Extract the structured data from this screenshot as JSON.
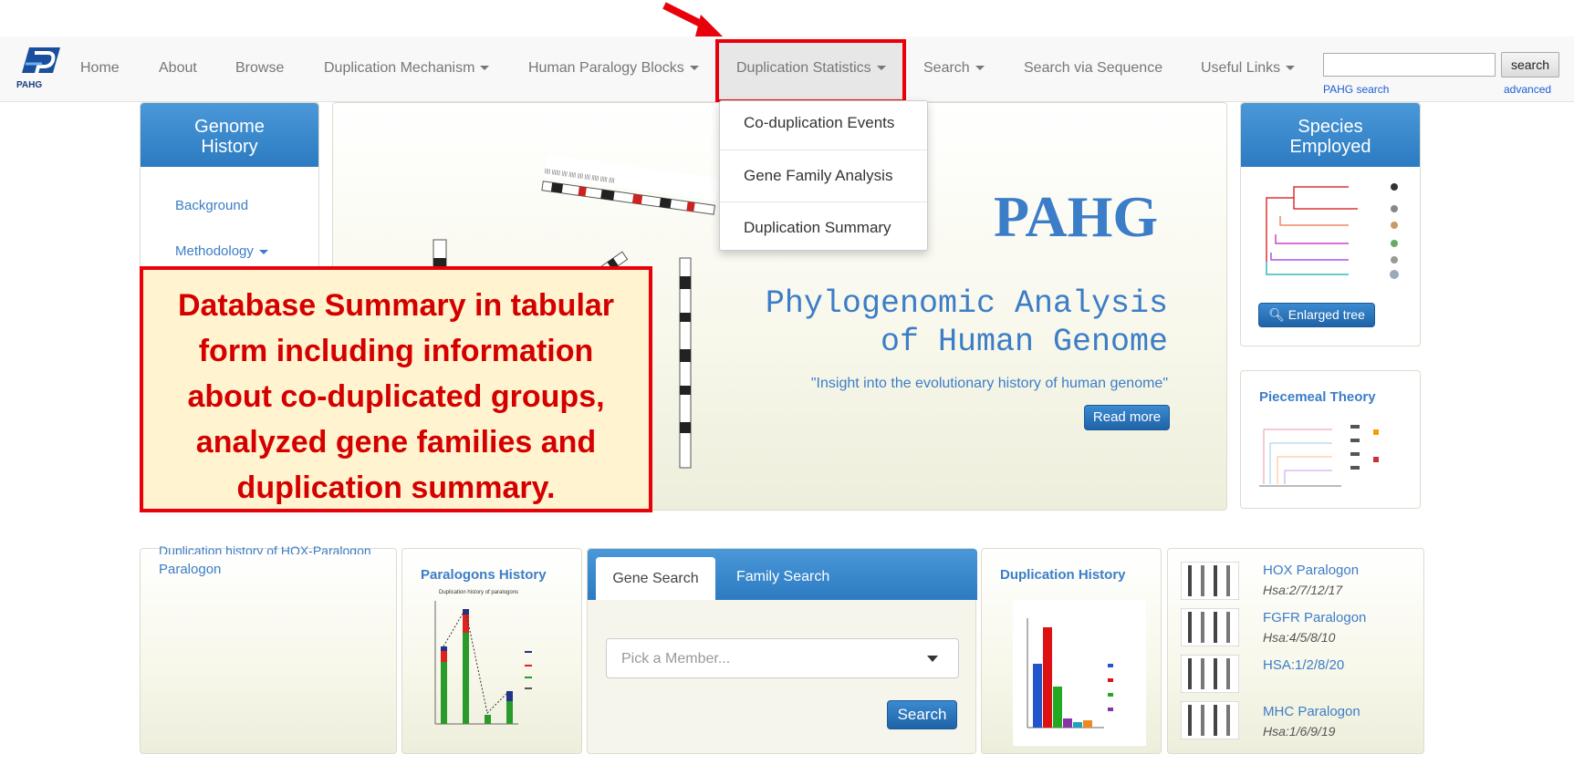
{
  "brand": {
    "logo_text": "PAHG"
  },
  "nav": {
    "home": "Home",
    "about": "About",
    "browse": "Browse",
    "duplication_mechanism": "Duplication Mechanism",
    "human_paralogy_blocks": "Human Paralogy Blocks",
    "duplication_statistics": "Duplication Statistics",
    "search": "Search",
    "search_via_sequence": "Search via Sequence",
    "useful_links": "Useful Links"
  },
  "site_search": {
    "button": "search",
    "link_pahg": "PAHG search",
    "link_advanced": "advanced",
    "value": ""
  },
  "dropdown": {
    "items": [
      "Co-duplication Events",
      "Gene Family Analysis",
      "Duplication Summary"
    ]
  },
  "genome_history": {
    "title_line1": "Genome",
    "title_line2": "History",
    "items": [
      "Background",
      "Methodology"
    ]
  },
  "hero": {
    "title": "PAHG",
    "subtitle_line1": "Phylogenomic Analysis",
    "subtitle_line2": "of Human Genome",
    "tagline": "\"Insight into the evolutionary history of human genome\"",
    "read_more": "Read more"
  },
  "species": {
    "title_line1": "Species",
    "title_line2": "Employed",
    "button": "Enlarged tree"
  },
  "piecemeal": {
    "title": "Piecemeal Theory"
  },
  "callout": {
    "text": "Database Summary in tabular form including information about co-duplicated groups, analyzed gene families and duplication summary."
  },
  "bottom_left": {
    "truncated_line": "Duplication history of HOX-Paralogon",
    "link": "Paralogon"
  },
  "paralogons_history": {
    "title": "Paralogons History",
    "chart_caption": "Duplication history of paralogons"
  },
  "gene_search": {
    "tab_gene": "Gene Search",
    "tab_family": "Family Search",
    "select_placeholder": "Pick a Member...",
    "search_button": "Search"
  },
  "duplication_history": {
    "title": "Duplication History"
  },
  "paralogon_list": [
    {
      "name": "HOX Paralogon",
      "loc": "Hsa:2/7/12/17"
    },
    {
      "name": "FGFR Paralogon",
      "loc": "Hsa:4/5/8/10"
    },
    {
      "name": "HSA:1/2/8/20",
      "loc": ""
    },
    {
      "name": "MHC Paralogon",
      "loc": "Hsa:1/6/9/19"
    }
  ],
  "colors": {
    "accent_red": "#e8000b",
    "link_blue": "#3c7dc7",
    "header_blue": "#2c7bc2"
  }
}
